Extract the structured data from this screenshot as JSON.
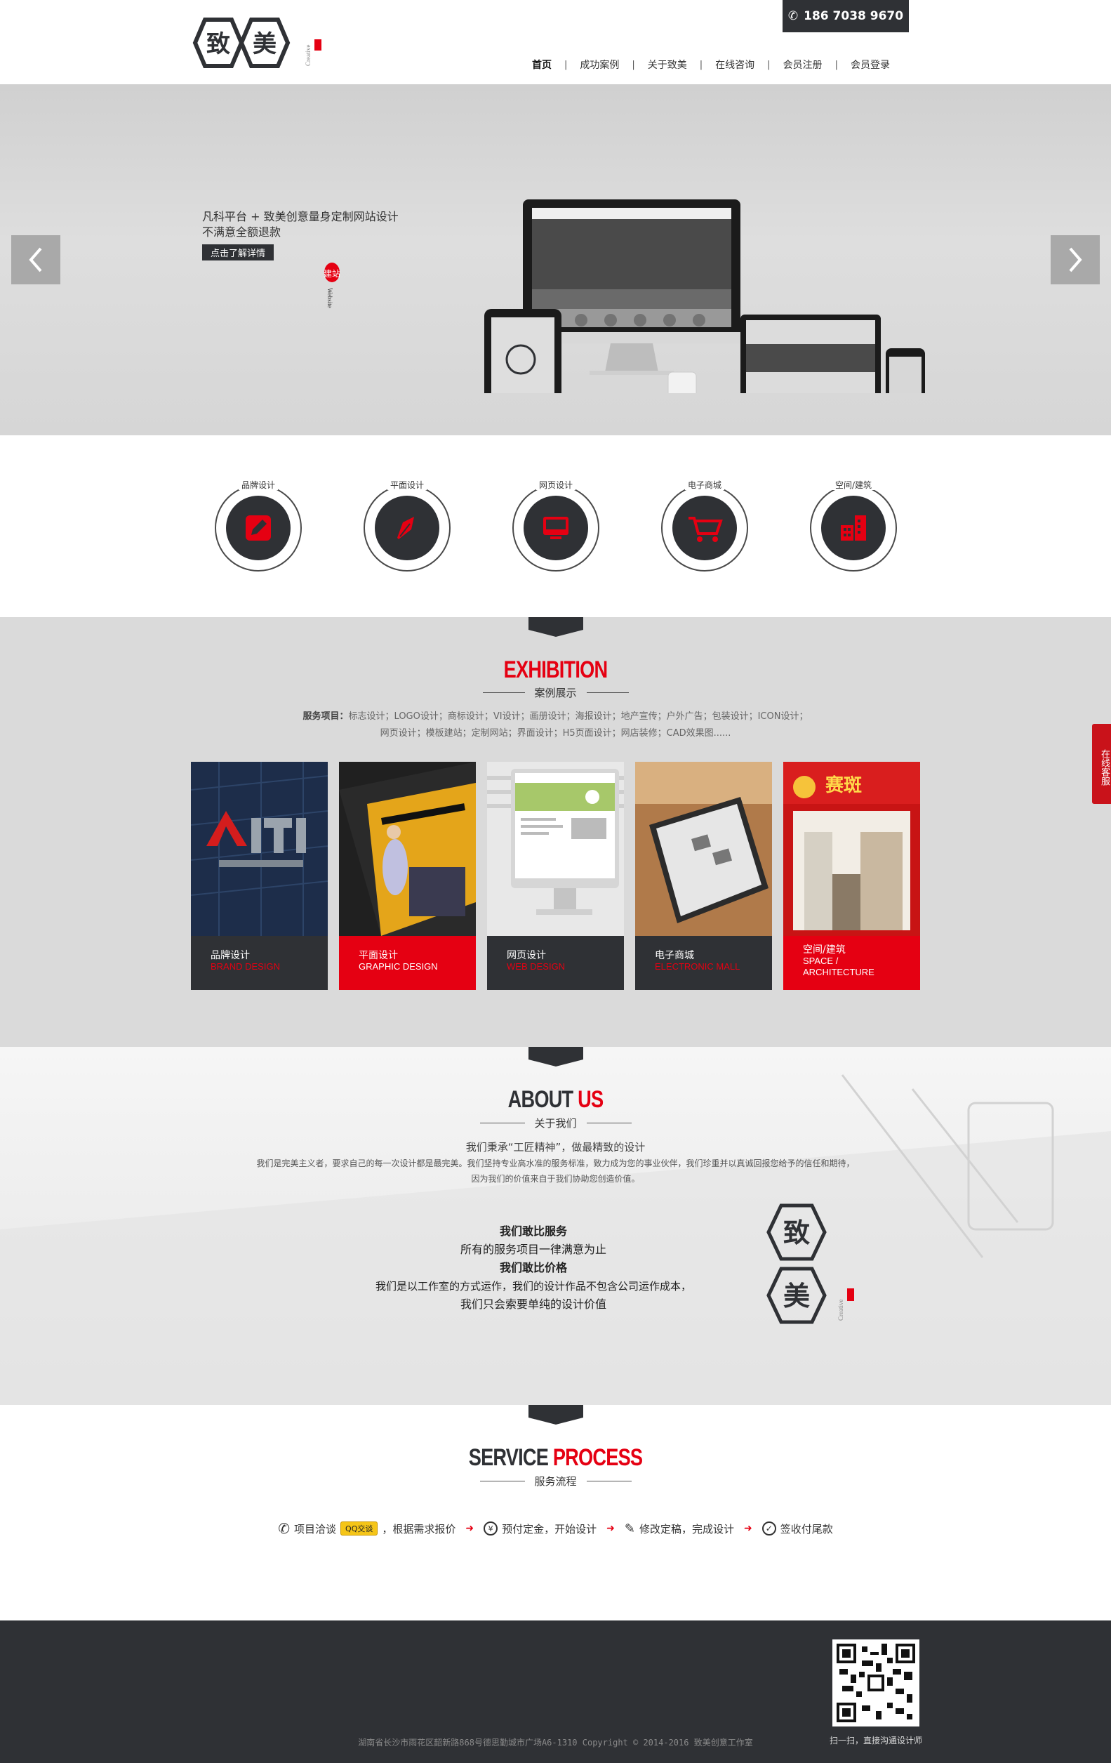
{
  "header": {
    "phone": "186 7038 9670",
    "nav": [
      "首页",
      "成功案例",
      "关于致美",
      "在线咨询",
      "会员注册",
      "会员登录"
    ]
  },
  "banner": {
    "line1": "凡科平台 + 致美创意量身定制网站设计",
    "line2": "不满意全额退款",
    "button": "点击了解详情",
    "seal_cn": "建站",
    "seal_en": "Website"
  },
  "services": [
    {
      "label": "品牌设计",
      "icon": "pencil-icon"
    },
    {
      "label": "平面设计",
      "icon": "pen-nib-icon"
    },
    {
      "label": "网页设计",
      "icon": "monitor-icon"
    },
    {
      "label": "电子商城",
      "icon": "cart-icon"
    },
    {
      "label": "空间/建筑",
      "icon": "building-icon"
    }
  ],
  "exhibition": {
    "title_a": "EXHIBITION",
    "subtitle": "案例展示",
    "list_label": "服务项目：",
    "list1": "标志设计；LOGO设计；商标设计；VI设计；画册设计；海报设计；地产宣传；户外广告；包装设计；ICON设计；",
    "list2": "网页设计；模板建站；定制网站；界面设计；H5页面设计；网店装修；CAD效果图......",
    "cards": [
      {
        "zh": "品牌设计",
        "en": "BRAND DESIGN"
      },
      {
        "zh": "平面设计",
        "en": "GRAPHIC DESIGN"
      },
      {
        "zh": "网页设计",
        "en": "WEB DESIGN"
      },
      {
        "zh": "电子商城",
        "en": "ELECTRONIC MALL"
      },
      {
        "zh": "空间/建筑",
        "en": "SPACE /",
        "en2": "ARCHITECTURE"
      }
    ]
  },
  "about": {
    "title_a": "ABOUT ",
    "title_b": "US",
    "subtitle": "关于我们",
    "slogan": "我们秉承“工匠精神”，做最精致的设计",
    "desc1": "我们是完美主义者，要求自己的每一次设计都是最完美。我们坚持专业高水准的服务标准，致力成为您的事业伙伴，我们珍重并以真诚回报您给予的信任和期待，",
    "desc2": "因为我们的价值来自于我们协助您创造价值。",
    "b1": "我们敢比服务",
    "b2": "所有的服务项目一律满意为止",
    "b3": "我们敢比价格",
    "b4": "我们是以工作室的方式运作，我们的设计作品不包含公司运作成本，",
    "b5": "我们只会索要单纯的设计价值"
  },
  "process": {
    "title_a": "SERVICE ",
    "title_b": "PROCESS",
    "subtitle": "服务流程",
    "step1": "项目洽谈",
    "qq": "QQ交谈",
    "step1b": "，根据需求报价",
    "step2": "预付定金，开始设计",
    "step3": "修改定稿，完成设计",
    "step4": "签收付尾款"
  },
  "footer": {
    "qr_caption": "扫一扫，直接沟通设计师",
    "copyright": "湖南省长沙市雨花区韶新路868号德思勤城市广场A6-1310  Copyright  ©  2014-2016  致美创意工作室"
  },
  "side_service": "在线客服",
  "colors": {
    "accent": "#e50012",
    "dark": "#2f3135"
  }
}
